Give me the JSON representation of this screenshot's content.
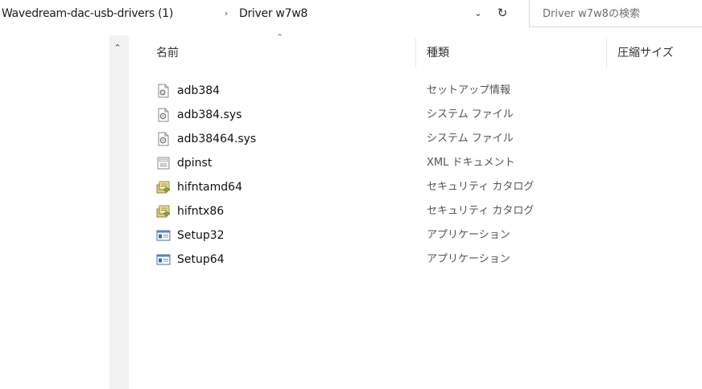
{
  "breadcrumb": {
    "parent": "Wavedream-dac-usb-drivers (1)",
    "separator": "›",
    "current": "Driver w7w8"
  },
  "search": {
    "placeholder": "Driver w7w8の検索"
  },
  "columns": {
    "name": "名前",
    "type": "種類",
    "size": "圧縮サイズ"
  },
  "files": [
    {
      "name": "adb384",
      "type": "セットアップ情報",
      "icon": "setup-info-icon"
    },
    {
      "name": "adb384.sys",
      "type": "システム ファイル",
      "icon": "system-file-icon"
    },
    {
      "name": "adb38464.sys",
      "type": "システム ファイル",
      "icon": "system-file-icon"
    },
    {
      "name": "dpinst",
      "type": "XML ドキュメント",
      "icon": "xml-document-icon"
    },
    {
      "name": "hifntamd64",
      "type": "セキュリティ カタログ",
      "icon": "security-catalog-icon"
    },
    {
      "name": "hifntx86",
      "type": "セキュリティ カタログ",
      "icon": "security-catalog-icon"
    },
    {
      "name": "Setup32",
      "type": "アプリケーション",
      "icon": "application-icon"
    },
    {
      "name": "Setup64",
      "type": "アプリケーション",
      "icon": "application-icon"
    }
  ]
}
